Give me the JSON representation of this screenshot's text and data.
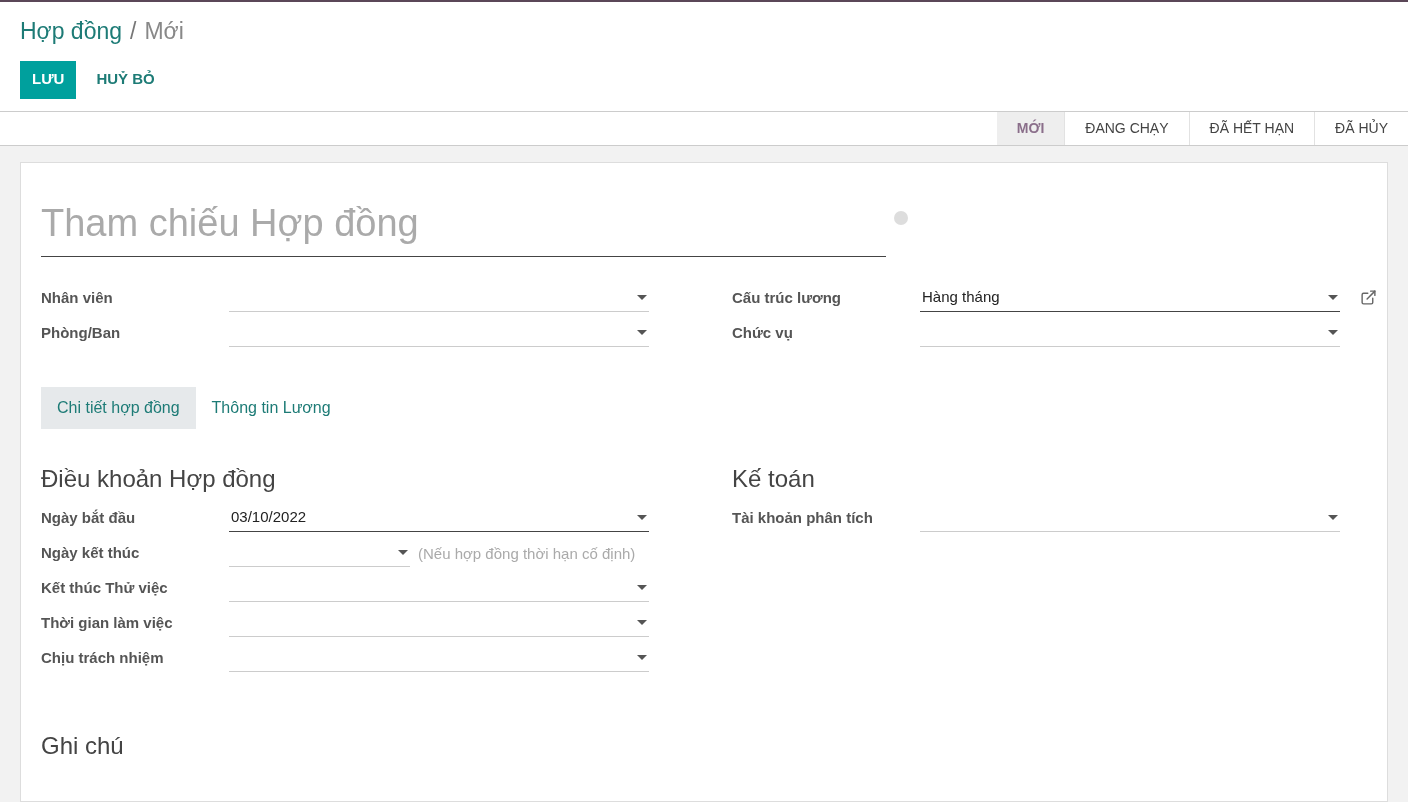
{
  "breadcrumb": {
    "parent": "Hợp đồng",
    "separator": "/",
    "current": "Mới"
  },
  "buttons": [
    {
      "label": "LƯU",
      "kind": "primary"
    },
    {
      "label": "HUỶ BỎ",
      "kind": "link"
    }
  ],
  "stages": [
    {
      "label": "MỚI",
      "selected": true
    },
    {
      "label": "ĐANG CHẠY",
      "selected": false
    },
    {
      "label": "ĐÃ HẾT HẠN",
      "selected": false
    },
    {
      "label": "ĐÃ HỦY",
      "selected": false
    }
  ],
  "title_field": {
    "placeholder": "Tham chiếu Hợp đồng"
  },
  "left_fields": [
    {
      "label": "Nhân viên"
    },
    {
      "label": "Phòng/Ban"
    }
  ],
  "right_fields": [
    {
      "label": "Cấu trúc lương",
      "value": "Hàng tháng",
      "link": true
    },
    {
      "label": "Chức vụ"
    }
  ],
  "tabs": [
    {
      "label": "Chi tiết hợp đồng",
      "selected": true
    },
    {
      "label": "Thông tin Lương",
      "selected": false
    }
  ],
  "terms": {
    "heading": "Điều khoản Hợp đồng",
    "fields": [
      {
        "label": "Ngày bắt đầu",
        "value": "03/10/2022"
      },
      {
        "label": "Ngày kết thúc",
        "hint": "(Nếu hợp đồng thời hạn cố định)"
      },
      {
        "label": "Kết thúc Thử việc"
      },
      {
        "label": "Thời gian làm việc"
      },
      {
        "label": "Chịu trách nhiệm"
      }
    ]
  },
  "accounting": {
    "heading": "Kế toán",
    "fields": [
      {
        "label": "Tài khoản phân tích"
      }
    ]
  },
  "notes": {
    "heading": "Ghi chú"
  }
}
